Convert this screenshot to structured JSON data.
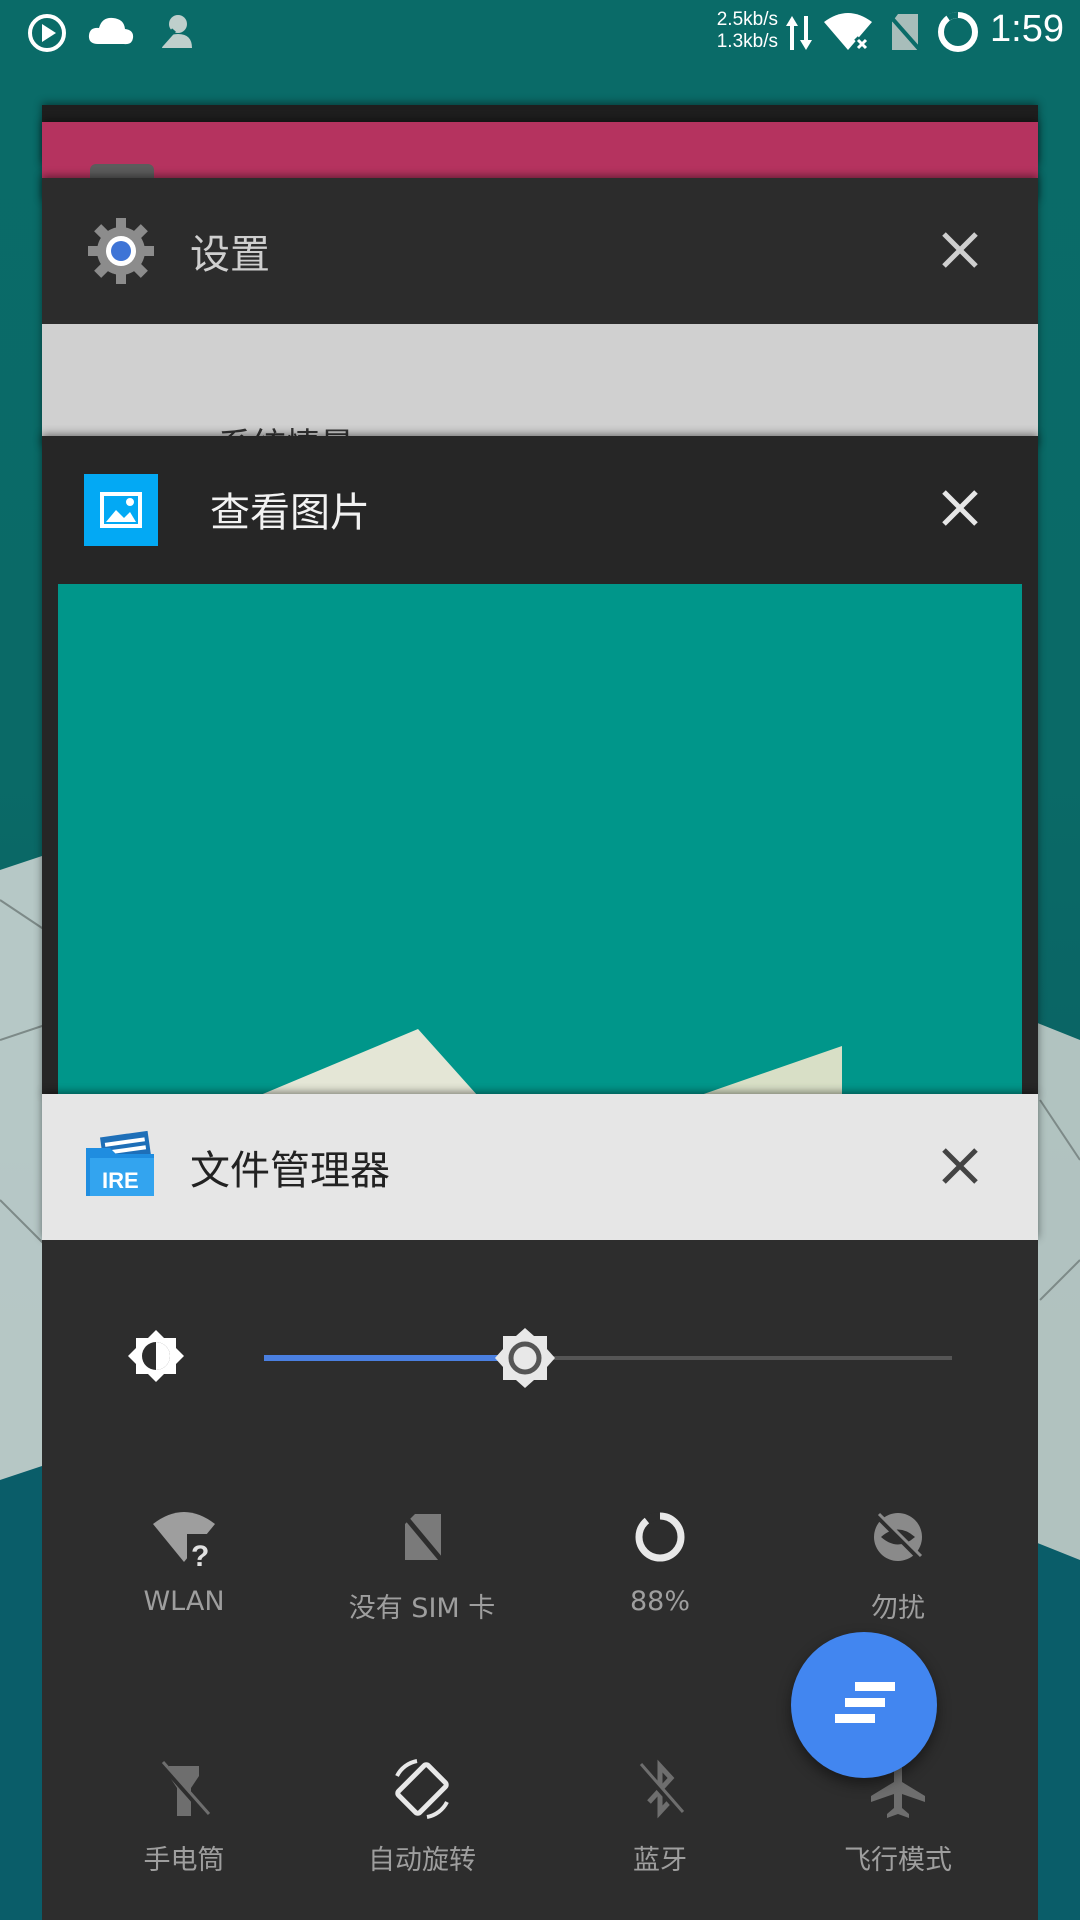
{
  "status_bar": {
    "speed_up": "2.5kb/s",
    "speed_down": "1.3kb/s",
    "time": "1:59",
    "icons": [
      "play-circle-icon",
      "cloud-icon",
      "person-icon",
      "data-arrows-icon",
      "wifi-icon",
      "no-sim-icon",
      "battery-ring-icon"
    ]
  },
  "recents": {
    "cards": [
      {
        "id": "pink-app",
        "title": "",
        "header_color": "#b5335f"
      },
      {
        "id": "settings",
        "title": "设置",
        "icon": "gear-icon",
        "header_color": "#2c2c2c",
        "preview_text": "系统情景"
      },
      {
        "id": "gallery",
        "title": "查看图片",
        "icon": "image-icon",
        "header_color": "#262626",
        "preview_color": "#00968a"
      },
      {
        "id": "file-manager",
        "title": "文件管理器",
        "icon": "file-manager-icon",
        "header_color": "#e6e6e6"
      }
    ]
  },
  "quick_settings": {
    "brightness_level": 0.38,
    "tiles_row1": [
      {
        "label": "WLAN",
        "icon": "wifi-unknown-icon"
      },
      {
        "label": "没有 SIM 卡",
        "icon": "no-sim-icon"
      },
      {
        "label": "88%",
        "icon": "battery-ring-icon"
      },
      {
        "label": "勿扰",
        "icon": "do-not-disturb-icon"
      }
    ],
    "tiles_row2": [
      {
        "label": "手电筒",
        "icon": "flashlight-off-icon"
      },
      {
        "label": "自动旋转",
        "icon": "auto-rotate-icon"
      },
      {
        "label": "蓝牙",
        "icon": "bluetooth-off-icon"
      },
      {
        "label": "飞行模式",
        "icon": "airplane-icon"
      }
    ]
  },
  "fab": {
    "icon": "clear-all-icon",
    "color": "#4286f0"
  }
}
